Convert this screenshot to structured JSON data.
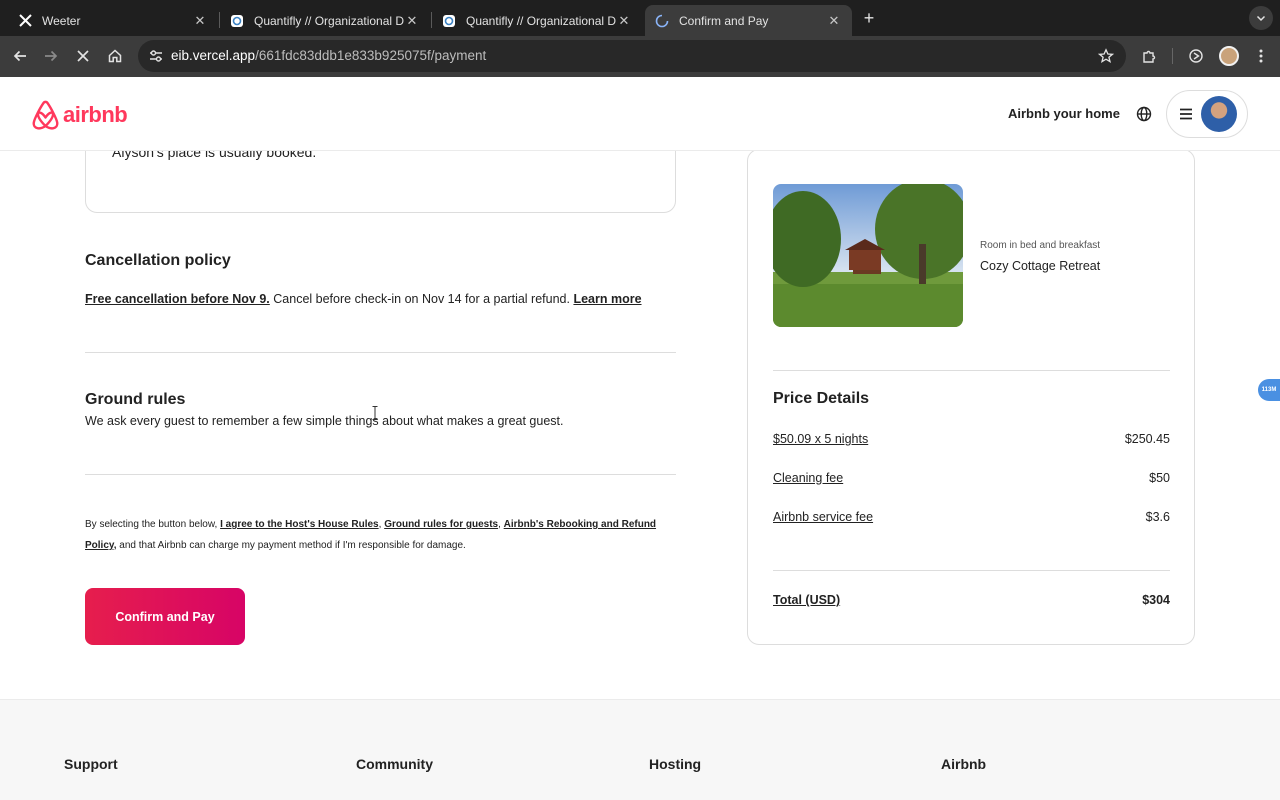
{
  "browser": {
    "tabs": [
      {
        "title": "Weeter",
        "icon": "x-logo-icon"
      },
      {
        "title": "Quantifly // Organizational Dia",
        "icon": "quantifly-icon"
      },
      {
        "title": "Quantifly // Organizational Dia",
        "icon": "quantifly-icon"
      },
      {
        "title": "Confirm and Pay",
        "icon": "loading-spinner-icon",
        "active": true
      }
    ],
    "url_host": "eib.vercel.app",
    "url_path": "/661fdc83ddb1e833b925075f/payment"
  },
  "header": {
    "logo_text": "airbnb",
    "host_link": "Airbnb your home"
  },
  "info_box": {
    "text": "Alyson's place is usually booked."
  },
  "cancellation": {
    "title": "Cancellation policy",
    "free_text": "Free cancellation before Nov 9.",
    "rest_text": " Cancel before check-in on Nov 14 for a partial refund. ",
    "learn_more": "Learn more"
  },
  "ground_rules": {
    "title": "Ground rules",
    "description": "We ask every guest to remember a few simple things about what makes a great guest."
  },
  "agreement": {
    "prefix": "By selecting the button below, ",
    "house_rules": "I agree to the Host's House Rules",
    "sep1": ", ",
    "guest_rules": "Ground rules for guests",
    "sep2": ", ",
    "rebooking": "Airbnb's Rebooking and Refund Policy,",
    "suffix": " and that Airbnb can charge my payment method if I'm responsible for damage."
  },
  "confirm_button": "Confirm and Pay",
  "listing": {
    "room_type": "Room in bed and breakfast",
    "name": "Cozy Cottage Retreat"
  },
  "price_details": {
    "title": "Price Details",
    "rows": [
      {
        "label": "$50.09 x 5 nights",
        "value": "$250.45"
      },
      {
        "label": "Cleaning fee",
        "value": "$50"
      },
      {
        "label": "Airbnb service fee",
        "value": "$3.6"
      }
    ],
    "total_label": "Total (USD)",
    "total_value": "$304"
  },
  "side_badge": "113M",
  "footer": {
    "columns": [
      "Support",
      "Community",
      "Hosting",
      "Airbnb"
    ]
  },
  "colors": {
    "brand": "#ff385c",
    "button_start": "#e61e4d",
    "button_end": "#d70466"
  }
}
